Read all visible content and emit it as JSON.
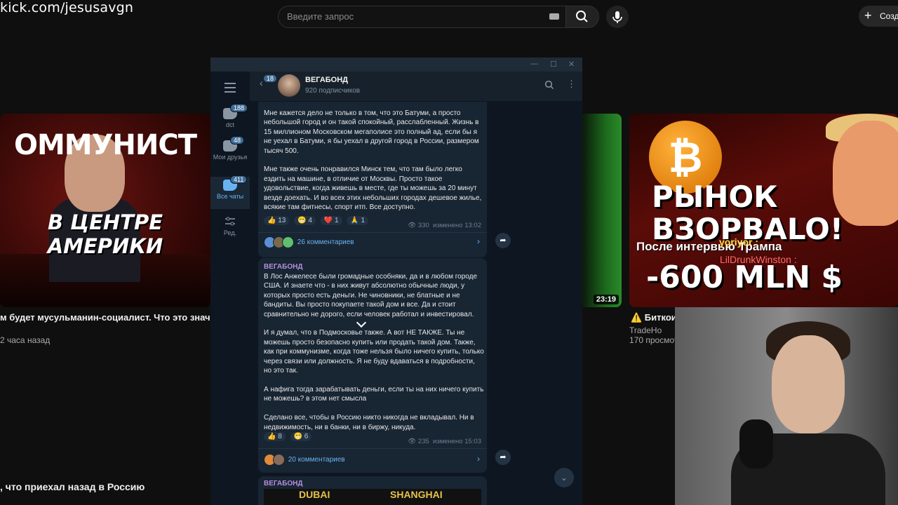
{
  "overlay": {
    "stream_url": "kick.com/jesusavgn"
  },
  "youtube": {
    "search_placeholder": "Введите запрос",
    "create_label": "Созд",
    "videos": [
      {
        "thumb_banner": "ОММУНИСТ",
        "thumb_caption": "В ЦЕНТРЕ АМЕРИКИ",
        "title": "м будет мусульманин-социалист. Что это значит?",
        "meta": "2 часа назад"
      },
      {
        "duration": "23:19"
      },
      {
        "thumb_line1": "РЫНОК",
        "thumb_line2": "ВЗОРВАLO!",
        "thumb_line3": "После интервью Трампа",
        "thumb_line4": "-600 MLN $",
        "title": "⚠️ Биткои",
        "channel": "TradeHo",
        "meta": "170 просмот"
      }
    ],
    "bottom_title": ", что приехал назад в Россию",
    "chat_overlay": [
      "yoriyor :",
      "LilDrunkWinston :"
    ]
  },
  "telegram": {
    "sidebar": [
      {
        "label": "dct",
        "badge": "188",
        "active": false
      },
      {
        "label": "Мои друзья",
        "badge": "48",
        "active": false
      },
      {
        "label": "Все чаты",
        "badge": "411",
        "active": true
      },
      {
        "label": "Ред.",
        "badge": "",
        "active": false
      }
    ],
    "header": {
      "back_badge": "18",
      "channel_name": "ВЕГАБОНД",
      "subscribers": "920 подписчиков"
    },
    "posts": [
      {
        "author": "",
        "text": "Мне кажется дело не только в том, что это Батуми, а просто небольшой город и он такой спокойный, расслабленный. Жизнь в 15 миллионом Московском мегаполисе это полный ад, если бы я не уехал в Батуми, я бы уехал в другой город в России, размером тысяч 500.\n\nМне также очень понравился Минск тем, что там было легко ездить на машине, в отличие от Москвы. Просто такое удовольствие, когда живешь в месте, где ты можешь за 20 минут везде доехать. И во всех этих небольших городах дешевое жилье, всякие там фитнесы, спорт итп. Все доступно.",
        "reactions": [
          "👍 13",
          "😁 4",
          "❤️ 1",
          "🙏 1"
        ],
        "views": "330",
        "edited": "изменено 13:02",
        "comments": "26 комментариев"
      },
      {
        "author": "ВЕГАБОНД",
        "text": "В Лос Анжелесе были громадные особняки, да и в любом городе США. И знаете что - в них живут абсолютно обычные люди, у которых просто есть деньги. Не чиновники, не блатные и не бандиты. Вы просто покупаете такой дом и все. Да и стоит сравнительно не дорого, если человек работал и инвестировал.\n\nИ я думал, что в Подмосковье также. А вот НЕ ТАКЖЕ. Ты не можешь просто безопасно купить или продать такой дом. Также, как при коммунизме, когда тоже нельзя было ничего купить, только через связи или должность. Я не буду вдаваться в подробности, но это так.\n\nА нафига тогда зарабатывать деньги, если ты на них ничего купить не можешь? в этом нет смысла\n\nСделано все, чтобы в Россию никто никогда не вкладывал. Ни в недвижимость, ни в банки, ни в биржу, никуда.",
        "reactions": [
          "👍 8",
          "😁 6"
        ],
        "views": "235",
        "edited": "изменено 15:03",
        "comments": "20 комментариев"
      },
      {
        "author": "ВЕГАБОНД",
        "image_labels": [
          "DUBAI",
          "SHANGHAI"
        ]
      }
    ]
  }
}
